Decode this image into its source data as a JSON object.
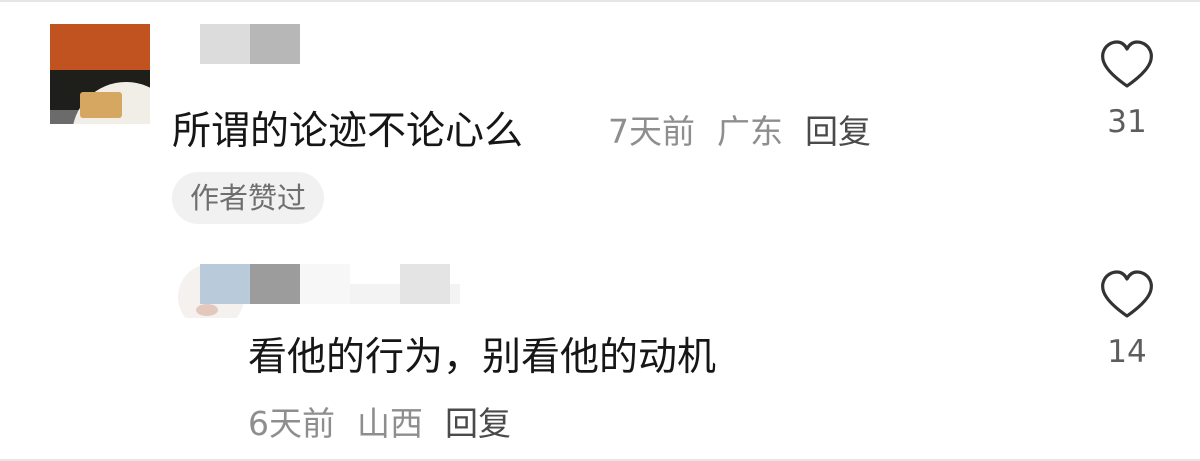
{
  "comments": [
    {
      "text": "所谓的论迹不论心么",
      "time": "7天前",
      "location": "广东",
      "reply_label": "回复",
      "badge": "作者赞过",
      "likes": "31",
      "like_icon": "heart-outline-icon",
      "username_obscured": true
    },
    {
      "text": "看他的行为，别看他的动机",
      "time": "6天前",
      "location": "山西",
      "reply_label": "回复",
      "likes": "14",
      "like_icon": "heart-outline-icon",
      "username_obscured": true
    }
  ],
  "colors": {
    "text_primary": "#161616",
    "text_meta": "#8e8e8e",
    "reply_text": "#4a4a4a",
    "badge_bg": "#f1f1f1",
    "heart_stroke": "#333333"
  }
}
